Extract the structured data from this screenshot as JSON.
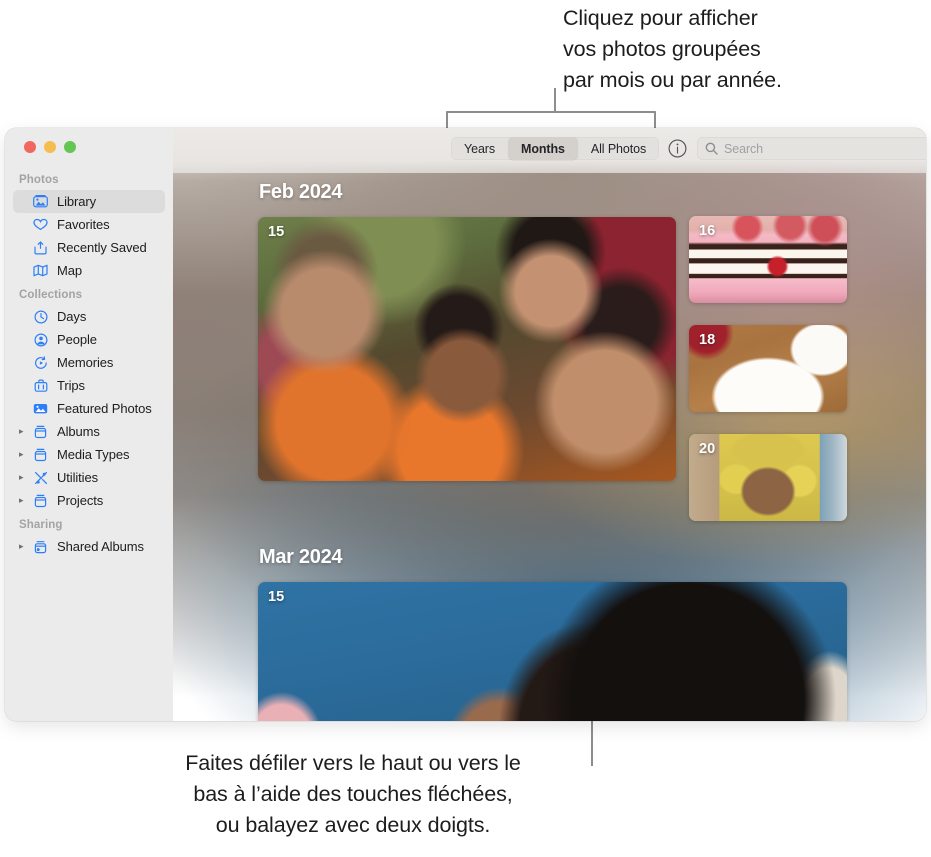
{
  "callouts": {
    "top": "Cliquez pour afficher\nvos photos groupées\npar mois ou par année.",
    "bottom": "Faites défiler vers le haut ou vers le\nbas à l’aide des touches fléchées,\nou balayez avec deux doigts."
  },
  "window": {
    "traffic_lights": [
      "close",
      "minimize",
      "zoom"
    ]
  },
  "sidebar": {
    "sections": [
      {
        "title": "Photos",
        "items": [
          {
            "label": "Library",
            "icon": "photo-library-icon",
            "selected": true,
            "expandable": false
          },
          {
            "label": "Favorites",
            "icon": "heart-icon",
            "selected": false,
            "expandable": false
          },
          {
            "label": "Recently Saved",
            "icon": "tray-download-icon",
            "selected": false,
            "expandable": false
          },
          {
            "label": "Map",
            "icon": "map-icon",
            "selected": false,
            "expandable": false
          }
        ]
      },
      {
        "title": "Collections",
        "items": [
          {
            "label": "Days",
            "icon": "clock-icon",
            "selected": false,
            "expandable": false
          },
          {
            "label": "People",
            "icon": "person-circle-icon",
            "selected": false,
            "expandable": false
          },
          {
            "label": "Memories",
            "icon": "memories-play-icon",
            "selected": false,
            "expandable": false
          },
          {
            "label": "Trips",
            "icon": "suitcase-icon",
            "selected": false,
            "expandable": false
          },
          {
            "label": "Featured Photos",
            "icon": "featured-photo-icon",
            "selected": false,
            "expandable": false
          },
          {
            "label": "Albums",
            "icon": "album-box-icon",
            "selected": false,
            "expandable": true
          },
          {
            "label": "Media Types",
            "icon": "album-box-icon",
            "selected": false,
            "expandable": true
          },
          {
            "label": "Utilities",
            "icon": "tools-icon",
            "selected": false,
            "expandable": true
          },
          {
            "label": "Projects",
            "icon": "album-box-icon",
            "selected": false,
            "expandable": true
          }
        ]
      },
      {
        "title": "Sharing",
        "items": [
          {
            "label": "Shared Albums",
            "icon": "shared-album-icon",
            "selected": false,
            "expandable": true
          }
        ]
      }
    ]
  },
  "toolbar": {
    "segments": [
      {
        "label": "Years",
        "active": false
      },
      {
        "label": "Months",
        "active": true
      },
      {
        "label": "All Photos",
        "active": false
      }
    ],
    "info_button": "info-icon",
    "search": {
      "placeholder": "Search",
      "value": "",
      "icon": "search-icon"
    }
  },
  "grid": {
    "months": [
      {
        "title": "Feb 2024",
        "tiles": [
          {
            "day": "15",
            "style": "ph-selfie",
            "alt": "group-selfie-four-people-park"
          },
          {
            "day": "16",
            "style": "ph-cake",
            "alt": "strawberry-cake-slice-with-cherry"
          },
          {
            "day": "18",
            "style": "ph-carrot",
            "alt": "roasted-carrots-on-white-plate"
          },
          {
            "day": "20",
            "style": "ph-beach",
            "alt": "person-in-yellow-at-beach"
          }
        ]
      },
      {
        "title": "Mar 2024",
        "tiles": [
          {
            "day": "15",
            "style": "ph-blue",
            "alt": "person-lying-down-blue-backdrop"
          }
        ]
      }
    ]
  },
  "colors": {
    "accent": "#2d7ff9",
    "sidebar_bg": "#ebebeb",
    "selection_bg": "#dcdcdc",
    "callout_text": "#1d1d1f",
    "leader_line": "#8d8d8d"
  }
}
